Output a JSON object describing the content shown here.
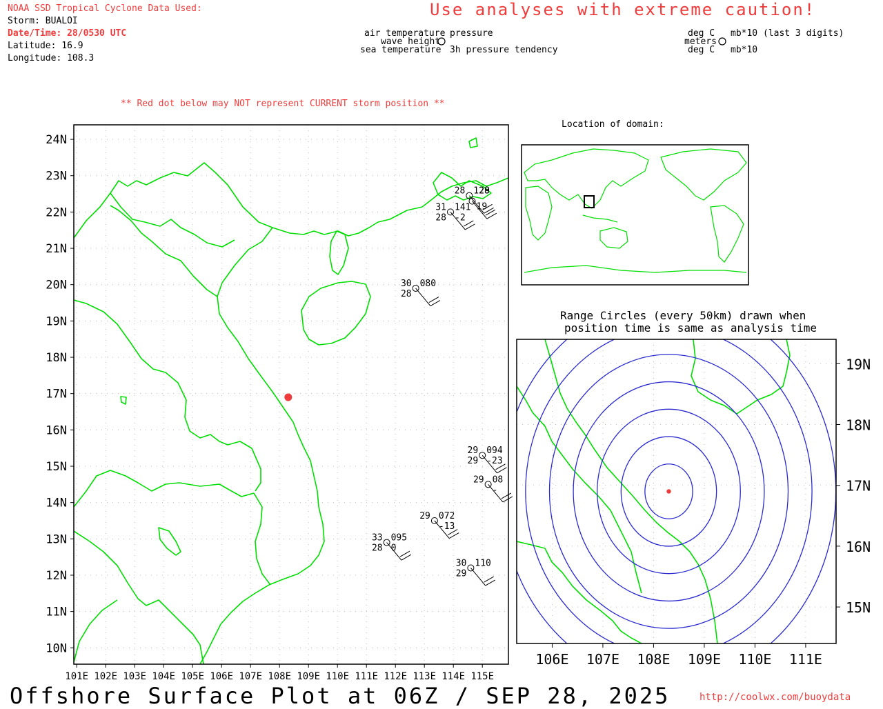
{
  "header": {
    "data_source": "NOAA SSD Tropical Cyclone Data Used:",
    "storm": "Storm: BUALOI",
    "datetime": "Date/Time: 28/0530 UTC",
    "latitude": "Latitude: 16.9",
    "longitude": "Longitude: 108.3",
    "caution": "Use analyses with extreme caution!",
    "red_dot_note": "** Red dot below may NOT represent CURRENT storm position **"
  },
  "legend": {
    "air_temperature": "air temperature",
    "wave_height": "wave height",
    "sea_temperature": "sea temperature",
    "pressure": "pressure",
    "pressure_tendency": "3h pressure tendency",
    "unit_air": "deg C",
    "unit_wave": "meters",
    "unit_sea": "deg C",
    "unit_pressure": "mb*10 (last 3 digits)",
    "unit_tendency": "mb*10"
  },
  "main_map": {
    "lat_labels": [
      "24N",
      "23N",
      "22N",
      "21N",
      "20N",
      "19N",
      "18N",
      "17N",
      "16N",
      "15N",
      "14N",
      "13N",
      "12N",
      "11N",
      "10N"
    ],
    "lon_labels": [
      "101E",
      "102E",
      "103E",
      "104E",
      "105E",
      "106E",
      "107E",
      "108E",
      "109E",
      "110E",
      "111E",
      "112E",
      "113E",
      "114E",
      "115E"
    ],
    "storm_position": {
      "lat": 16.9,
      "lon": 108.3
    },
    "stations": [
      {
        "air": "28",
        "sea": "",
        "pressure": "128",
        "tendency": "",
        "extra": "29",
        "lat": 22.45,
        "lon": 114.55
      },
      {
        "air": "31",
        "sea": "28",
        "pressure": "141",
        "tendency": "-2",
        "lat": 22.0,
        "lon": 113.9
      },
      {
        "air": "",
        "sea": "",
        "pressure": "",
        "tendency": "19",
        "lat": 22.3,
        "lon": 114.65
      },
      {
        "air": "30",
        "sea": "28",
        "pressure": "080",
        "tendency": "",
        "lat": 19.9,
        "lon": 112.7
      },
      {
        "air": "29",
        "sea": "29",
        "pressure": "094",
        "tendency": "-23",
        "lat": 15.3,
        "lon": 115.0
      },
      {
        "air": "29",
        "sea": "",
        "pressure": "08",
        "tendency": "-",
        "lat": 14.5,
        "lon": 115.2
      },
      {
        "air": "29",
        "sea": "",
        "pressure": "072",
        "tendency": "-13",
        "lat": 13.5,
        "lon": 113.35
      },
      {
        "air": "33",
        "sea": "28",
        "pressure": "095",
        "tendency": "0",
        "lat": 12.9,
        "lon": 111.7
      },
      {
        "air": "30",
        "sea": "29",
        "pressure": "110",
        "tendency": "",
        "lat": 12.2,
        "lon": 114.6
      }
    ]
  },
  "inset_location": {
    "title": "Location of domain:"
  },
  "range_map": {
    "title_line1": "Range Circles (every 50km) drawn when",
    "title_line2": "position time is same as analysis time",
    "lat_labels": [
      "19N",
      "18N",
      "17N",
      "16N",
      "15N"
    ],
    "lon_labels": [
      "106E",
      "107E",
      "108E",
      "109E",
      "110E",
      "111E"
    ],
    "ring_spacing_km": 50,
    "ring_count": 7
  },
  "footer": {
    "title": "Offshore Surface Plot at 06Z / SEP 28, 2025",
    "url": "http://coolwx.com/buoydata"
  },
  "colors": {
    "coast": "#00dd00",
    "rings": "#2a2ad0",
    "storm": "#ef3b3b",
    "grid": "#bbbbbb"
  }
}
